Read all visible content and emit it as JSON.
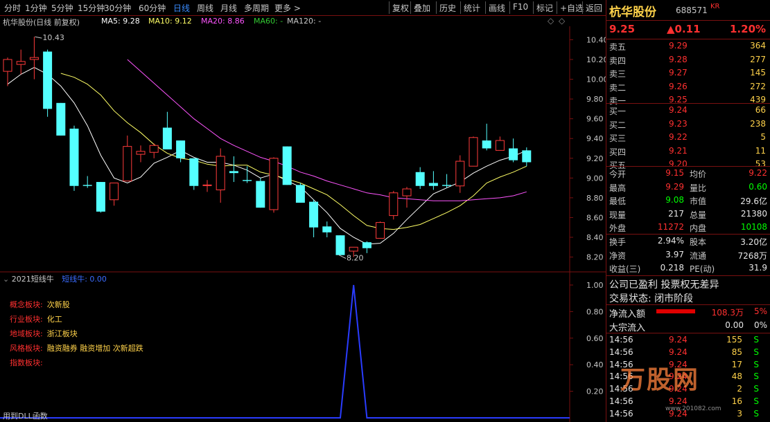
{
  "toolbar": {
    "periods": [
      "分时",
      "1分钟",
      "5分钟",
      "15分钟",
      "30分钟",
      "60分钟",
      "日线",
      "周线",
      "月线",
      "多周期",
      "更多 >"
    ],
    "active": "日线",
    "actions": [
      "复权",
      "叠加",
      "历史",
      "统计",
      "画线",
      "F10",
      "标记",
      "+自选",
      "返回"
    ]
  },
  "chart_header": {
    "title": "杭华股份(日线 前复权)",
    "ma5": "MA5: 9.28",
    "ma10": "MA10: 9.12",
    "ma20": "MA20: 8.86",
    "ma60": "MA60: -",
    "ma120": "MA120: -",
    "colors": {
      "ma5": "#ffffff",
      "ma10": "#ffff66",
      "ma20": "#ff55ff",
      "ma60": "#33cc33",
      "ma120": "#c8c8c8"
    }
  },
  "chart_data": [
    {
      "type": "candlestick",
      "title": "杭华股份(日线 前复权)",
      "price_axis_ticks": [
        "10.40",
        "10.20",
        "10.00",
        "9.80",
        "9.60",
        "9.40",
        "9.20",
        "9.00",
        "8.80",
        "8.60",
        "8.40",
        "8.20"
      ],
      "ylim": [
        8.12,
        10.48
      ],
      "annotations": {
        "high_label": "10.43",
        "low_label": "8.20"
      },
      "candles": [
        {
          "o": 10.08,
          "h": 10.22,
          "l": 9.93,
          "c": 10.2
        },
        {
          "o": 10.15,
          "h": 10.3,
          "l": 10.05,
          "c": 10.18
        },
        {
          "o": 10.2,
          "h": 10.43,
          "l": 10.0,
          "c": 10.22
        },
        {
          "o": 10.28,
          "h": 10.3,
          "l": 9.62,
          "c": 9.7
        },
        {
          "o": 9.76,
          "h": 9.76,
          "l": 9.43,
          "c": 9.43
        },
        {
          "o": 9.5,
          "h": 9.53,
          "l": 8.87,
          "c": 8.92
        },
        {
          "o": 8.93,
          "h": 9.02,
          "l": 8.9,
          "c": 8.92
        },
        {
          "o": 8.96,
          "h": 8.96,
          "l": 8.65,
          "c": 8.66
        },
        {
          "o": 8.78,
          "h": 8.95,
          "l": 8.72,
          "c": 8.95
        },
        {
          "o": 8.97,
          "h": 9.43,
          "l": 8.97,
          "c": 9.32
        },
        {
          "o": 9.24,
          "h": 9.33,
          "l": 9.16,
          "c": 9.27
        },
        {
          "o": 9.26,
          "h": 9.35,
          "l": 9.2,
          "c": 9.33
        },
        {
          "o": 9.51,
          "h": 9.67,
          "l": 9.29,
          "c": 9.29
        },
        {
          "o": 9.38,
          "h": 9.38,
          "l": 9.16,
          "c": 9.2
        },
        {
          "o": 9.2,
          "h": 9.2,
          "l": 8.88,
          "c": 8.92
        },
        {
          "o": 8.93,
          "h": 8.98,
          "l": 8.86,
          "c": 8.93
        },
        {
          "o": 8.88,
          "h": 9.3,
          "l": 8.75,
          "c": 9.22
        },
        {
          "o": 9.07,
          "h": 9.22,
          "l": 8.96,
          "c": 9.05
        },
        {
          "o": 8.98,
          "h": 9.12,
          "l": 8.95,
          "c": 8.97
        },
        {
          "o": 8.97,
          "h": 9.0,
          "l": 8.7,
          "c": 8.7
        },
        {
          "o": 8.68,
          "h": 9.21,
          "l": 8.65,
          "c": 9.2
        },
        {
          "o": 9.32,
          "h": 9.32,
          "l": 8.93,
          "c": 8.93
        },
        {
          "o": 8.93,
          "h": 8.95,
          "l": 8.75,
          "c": 8.75
        },
        {
          "o": 8.76,
          "h": 8.78,
          "l": 8.4,
          "c": 8.5
        },
        {
          "o": 8.51,
          "h": 8.56,
          "l": 8.4,
          "c": 8.45
        },
        {
          "o": 8.42,
          "h": 8.42,
          "l": 8.22,
          "c": 8.22
        },
        {
          "o": 8.26,
          "h": 8.3,
          "l": 8.2,
          "c": 8.3
        },
        {
          "o": 8.35,
          "h": 8.36,
          "l": 8.24,
          "c": 8.29
        },
        {
          "o": 8.39,
          "h": 8.56,
          "l": 8.39,
          "c": 8.55
        },
        {
          "o": 8.62,
          "h": 8.87,
          "l": 8.58,
          "c": 8.85
        },
        {
          "o": 8.82,
          "h": 8.91,
          "l": 8.7,
          "c": 8.89
        },
        {
          "o": 9.06,
          "h": 9.11,
          "l": 8.89,
          "c": 8.92
        },
        {
          "o": 8.95,
          "h": 9.07,
          "l": 8.88,
          "c": 8.92
        },
        {
          "o": 8.93,
          "h": 9.04,
          "l": 8.9,
          "c": 8.92
        },
        {
          "o": 8.92,
          "h": 9.23,
          "l": 8.85,
          "c": 9.17
        },
        {
          "o": 9.12,
          "h": 9.42,
          "l": 9.12,
          "c": 9.41
        },
        {
          "o": 9.38,
          "h": 9.55,
          "l": 9.28,
          "c": 9.3
        },
        {
          "o": 9.28,
          "h": 9.42,
          "l": 9.28,
          "c": 9.38
        },
        {
          "o": 9.3,
          "h": 9.4,
          "l": 9.16,
          "c": 9.18
        },
        {
          "o": 9.28,
          "h": 9.31,
          "l": 9.12,
          "c": 9.16
        }
      ],
      "ma": {
        "MA5": [
          9.95,
          10.05,
          10.12,
          10.05,
          9.93,
          9.76,
          9.53,
          9.23,
          9.0,
          8.95,
          9.01,
          9.15,
          9.21,
          9.28,
          9.21,
          9.16,
          9.16,
          9.13,
          9.08,
          9.0,
          9.04,
          8.97,
          8.91,
          8.78,
          8.65,
          8.49,
          8.4,
          8.33,
          8.34,
          8.44,
          8.58,
          8.71,
          8.84,
          8.9,
          8.96,
          9.05,
          9.12,
          9.18,
          9.22,
          9.28
        ],
        "MA10": [
          null,
          null,
          null,
          null,
          10.06,
          10.02,
          9.95,
          9.84,
          9.68,
          9.56,
          9.46,
          9.34,
          9.25,
          9.2,
          9.18,
          9.14,
          9.12,
          9.13,
          9.13,
          9.06,
          9.03,
          8.99,
          8.95,
          8.89,
          8.83,
          8.73,
          8.62,
          8.52,
          8.49,
          8.48,
          8.5,
          8.53,
          8.59,
          8.65,
          8.72,
          8.82,
          8.95,
          9.01,
          9.06,
          9.12
        ],
        "MA20": [
          null,
          null,
          null,
          null,
          null,
          null,
          null,
          null,
          null,
          10.2,
          10.08,
          9.96,
          9.84,
          9.72,
          9.6,
          9.5,
          9.4,
          9.33,
          9.27,
          9.21,
          9.17,
          9.12,
          9.06,
          9.02,
          8.97,
          8.93,
          8.89,
          8.85,
          8.83,
          8.8,
          8.79,
          8.78,
          8.77,
          8.77,
          8.77,
          8.78,
          8.79,
          8.8,
          8.82,
          8.86
        ]
      }
    },
    {
      "type": "line",
      "title": "2021短线牛",
      "series": [
        {
          "name": "短线牛",
          "values": [
            0,
            0,
            0,
            0,
            0,
            0,
            0,
            0,
            0,
            0,
            0,
            0,
            0,
            0,
            0,
            0,
            0,
            0,
            0,
            0,
            0,
            0,
            0,
            0,
            0,
            0,
            1,
            0,
            0,
            0,
            0,
            0,
            0,
            0,
            0,
            0,
            0,
            0,
            0,
            0
          ]
        }
      ],
      "y_axis_ticks": [
        "1.00",
        "0.80",
        "0.60",
        "0.40",
        "0.20"
      ],
      "ylim": [
        0,
        1.0
      ]
    }
  ],
  "indicator": {
    "name": "2021短线牛",
    "series_label": "短线牛: 0.00",
    "footer": "用到DLL函数",
    "blocks": [
      {
        "key": "概念板块:",
        "value": "次新股"
      },
      {
        "key": "行业板块:",
        "value": "化工"
      },
      {
        "key": "地域板块:",
        "value": "浙江板块"
      },
      {
        "key": "风格板块:",
        "value": "融资融券 融资增加 次新超跌"
      },
      {
        "key": "指数板块:",
        "value": ""
      }
    ]
  },
  "quote": {
    "name": "杭华股份",
    "code": "688571",
    "tag": "KR",
    "price": "9.25",
    "change": "▲0.11",
    "change_pct": "1.20%",
    "asks": [
      {
        "label": "卖五",
        "price": "9.29",
        "vol": "364"
      },
      {
        "label": "卖四",
        "price": "9.28",
        "vol": "277"
      },
      {
        "label": "卖三",
        "price": "9.27",
        "vol": "145"
      },
      {
        "label": "卖二",
        "price": "9.26",
        "vol": "272"
      },
      {
        "label": "卖一",
        "price": "9.25",
        "vol": "439"
      }
    ],
    "bids": [
      {
        "label": "买一",
        "price": "9.24",
        "vol": "66"
      },
      {
        "label": "买二",
        "price": "9.23",
        "vol": "238"
      },
      {
        "label": "买三",
        "price": "9.22",
        "vol": "5"
      },
      {
        "label": "买四",
        "price": "9.21",
        "vol": "11"
      },
      {
        "label": "买五",
        "price": "9.20",
        "vol": "53"
      }
    ],
    "stats": [
      {
        "k1": "今开",
        "v1": "9.15",
        "c1": "red",
        "k2": "均价",
        "v2": "9.22",
        "c2": "red"
      },
      {
        "k1": "最高",
        "v1": "9.29",
        "c1": "red",
        "k2": "量比",
        "v2": "0.60",
        "c2": "green"
      },
      {
        "k1": "最低",
        "v1": "9.08",
        "c1": "green",
        "k2": "市值",
        "v2": "29.6亿",
        "c2": "white"
      },
      {
        "k1": "现量",
        "v1": "217",
        "c1": "white",
        "k2": "总量",
        "v2": "21380",
        "c2": "white"
      },
      {
        "k1": "外盘",
        "v1": "11272",
        "c1": "red",
        "k2": "内盘",
        "v2": "10108",
        "c2": "green"
      }
    ],
    "fin": [
      {
        "k1": "换手",
        "v1": "2.94%",
        "k2": "股本",
        "v2": "3.20亿"
      },
      {
        "k1": "净资",
        "v1": "3.97",
        "k2": "流通",
        "v2": "7268万"
      },
      {
        "k1": "收益(三)",
        "v1": "0.218",
        "k2": "PE(动)",
        "v2": "31.9"
      }
    ],
    "notes": [
      "公司已盈利 投票权无差异",
      "交易状态: 闭市阶段"
    ],
    "flow": [
      {
        "label": "净流入额",
        "value": "108.3万",
        "pct": "5%",
        "bar": 0.7
      },
      {
        "label": "大宗流入",
        "value": "0.00",
        "pct": "0%",
        "bar": 0
      }
    ],
    "ticks": [
      {
        "t": "14:56",
        "p": "9.24",
        "v": "155",
        "d": "S"
      },
      {
        "t": "14:56",
        "p": "9.24",
        "v": "85",
        "d": "S"
      },
      {
        "t": "14:56",
        "p": "9.24",
        "v": "17",
        "d": "S"
      },
      {
        "t": "14:56",
        "p": "9.24",
        "v": "48",
        "d": "S"
      },
      {
        "t": "14:56",
        "p": "9.24",
        "v": "2",
        "d": "S"
      },
      {
        "t": "14:56",
        "p": "9.24",
        "v": "16",
        "d": "S"
      },
      {
        "t": "14:56",
        "p": "9.24",
        "v": "3",
        "d": "S"
      }
    ]
  },
  "watermark": {
    "text": "万股网",
    "url": "www.201082.com"
  }
}
